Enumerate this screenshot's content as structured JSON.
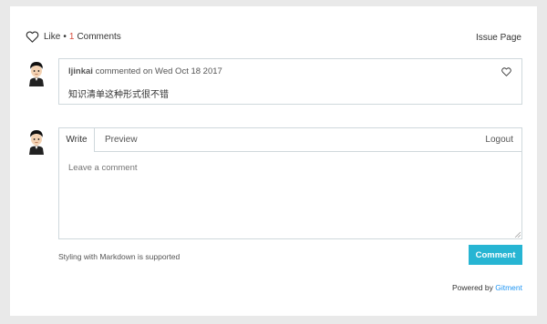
{
  "header": {
    "like_label": "Like",
    "separator": "•",
    "comment_count": "1",
    "comments_label": "Comments",
    "issue_link": "Issue Page"
  },
  "comment": {
    "author": "ljinkai",
    "meta": " commented on Wed Oct 18 2017",
    "body": "知识清单这种形式很不错"
  },
  "editor": {
    "tab_write": "Write",
    "tab_preview": "Preview",
    "logout": "Logout",
    "placeholder": "Leave a comment"
  },
  "footer": {
    "markdown_note": "Styling with Markdown is supported",
    "submit_label": "Comment",
    "powered_prefix": "Powered by ",
    "powered_brand": "Gitment"
  },
  "colors": {
    "accent": "#27b5d3",
    "count": "#d64c3c",
    "brand_link": "#2196f3"
  },
  "icons": {
    "like": "heart-outline-icon",
    "comment_like": "heart-outline-icon",
    "avatar": "user-avatar"
  }
}
